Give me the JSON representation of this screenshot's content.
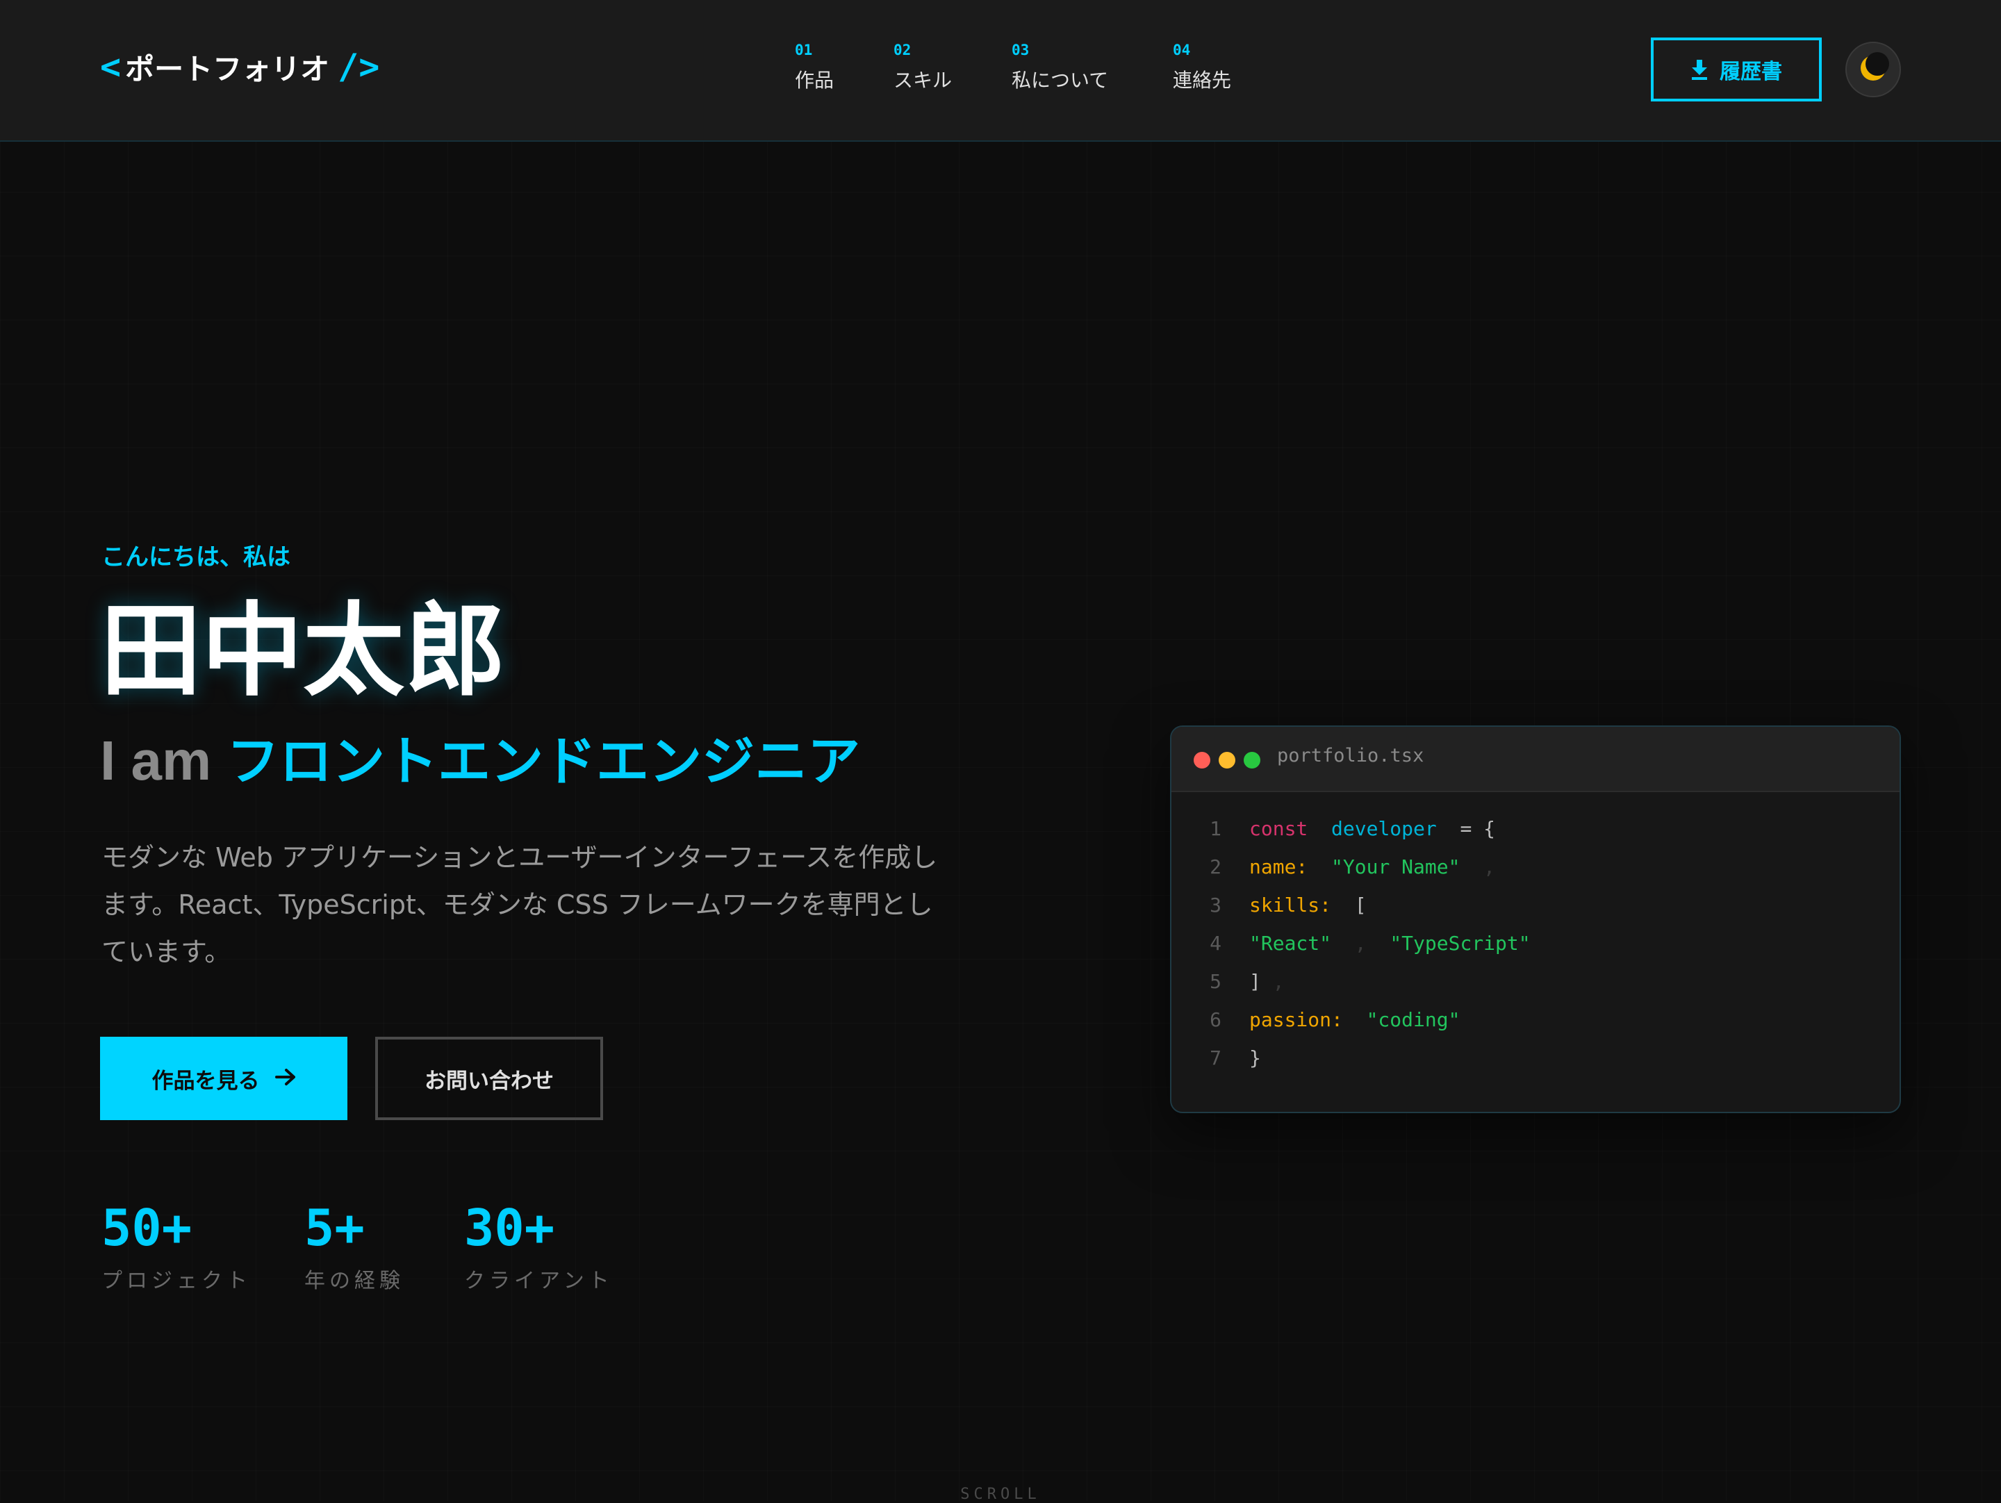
{
  "header": {
    "logo": {
      "open": "<",
      "name": "ポートフォリオ",
      "close": "/>"
    },
    "nav": [
      {
        "num": "01",
        "label": "作品"
      },
      {
        "num": "02",
        "label": "スキル"
      },
      {
        "num": "03",
        "label": "私について"
      },
      {
        "num": "04",
        "label": "連絡先"
      }
    ],
    "resume_label": "履歴書",
    "theme_icon": "moon-icon"
  },
  "hero": {
    "greeting": "こんにちは、私は",
    "name": "田中太郎",
    "role_prefix": "I am",
    "role": "フロントエンドエンジニア",
    "description": "モダンな Web アプリケーションとユーザーインターフェースを作成します。React、TypeScript、モダンな CSS フレームワークを専門としています。",
    "primary_button": "作品を見る",
    "primary_icon": "arrow-right-icon",
    "secondary_button": "お問い合わせ",
    "stats": [
      {
        "value": "50+",
        "label": "プロジェクト"
      },
      {
        "value": "5+",
        "label": "年の経験"
      },
      {
        "value": "30+",
        "label": "クライアント"
      }
    ]
  },
  "code_window": {
    "filename": "portfolio.tsx",
    "lines": [
      {
        "n": "1",
        "kw": "const",
        "var": "developer",
        "rest": " = {"
      },
      {
        "n": "2",
        "prop": "name:",
        "str": "\"Your Name\"",
        "faint": ","
      },
      {
        "n": "3",
        "prop": "skills:",
        "rest": "["
      },
      {
        "n": "4",
        "str": "\"React\"",
        "faint": ",",
        "str2": "\"TypeScript\""
      },
      {
        "n": "5",
        "rest": "]",
        "faint": ","
      },
      {
        "n": "6",
        "prop": "passion:",
        "str": "\"coding\""
      },
      {
        "n": "7",
        "rest": "}"
      }
    ],
    "dot_colors": [
      "#ff5f57",
      "#febc2e",
      "#28c840"
    ]
  },
  "scroll_hint": "SCROLL",
  "colors": {
    "accent": "#00cfff",
    "background": "#0d0d0d",
    "header": "#1b1b1b"
  }
}
